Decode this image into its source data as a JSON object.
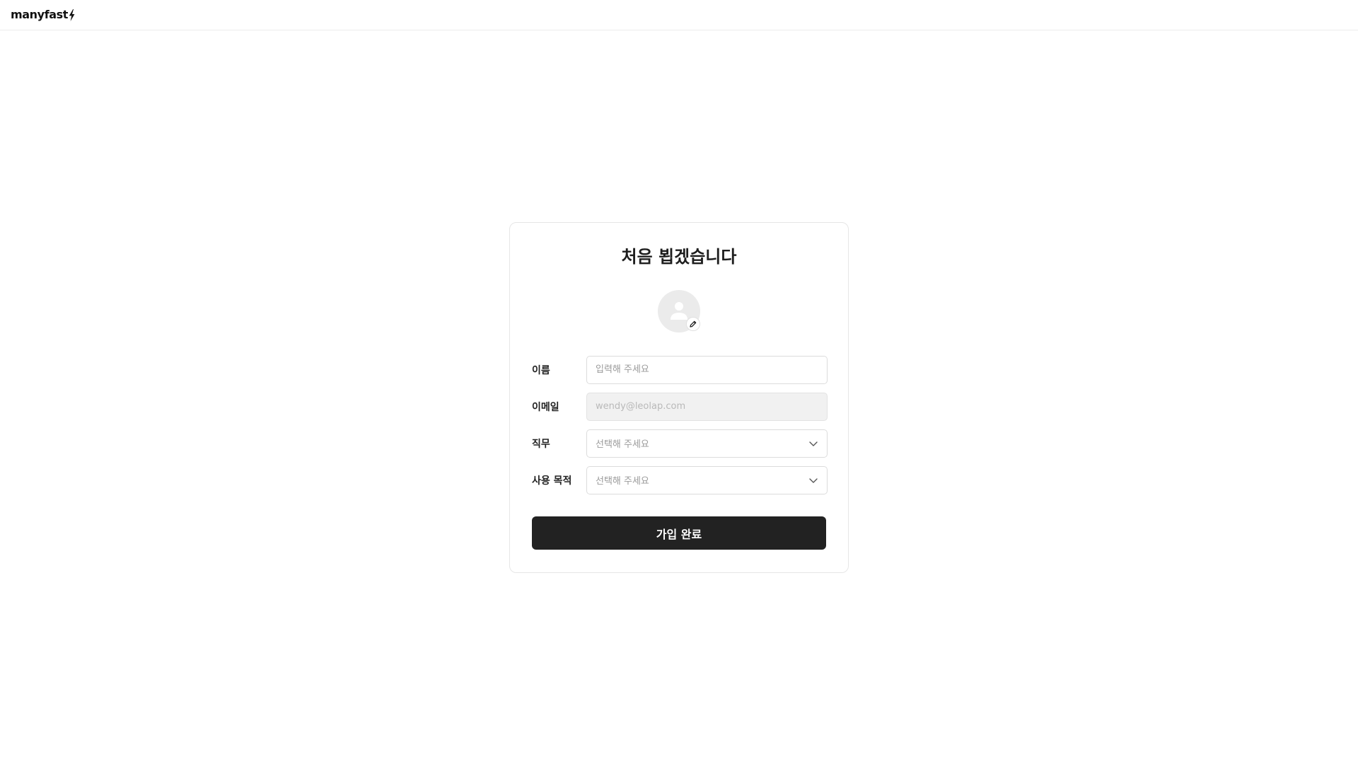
{
  "header": {
    "logo_text": "manyfast",
    "logo_icon": "bolt-icon"
  },
  "signup": {
    "title": "처음 뵙겠습니다",
    "avatar": {
      "icon": "person-icon",
      "edit_icon": "pencil-icon"
    },
    "fields": {
      "name": {
        "label": "이름",
        "placeholder": "입력해 주세요",
        "value": ""
      },
      "email": {
        "label": "이메일",
        "value": "wendy@leolap.com",
        "disabled": true
      },
      "job": {
        "label": "직무",
        "selected": "선택해 주세요",
        "icon": "chevron-down-icon"
      },
      "purpose": {
        "label": "사용 목적",
        "selected": "선택해 주세요",
        "icon": "chevron-down-icon"
      }
    },
    "submit_label": "가입 완료"
  },
  "colors": {
    "button_bg": "#222222",
    "card_border": "#e6e6e6",
    "disabled_field_bg": "#f1f1f1",
    "avatar_bg": "#ebebeb"
  }
}
